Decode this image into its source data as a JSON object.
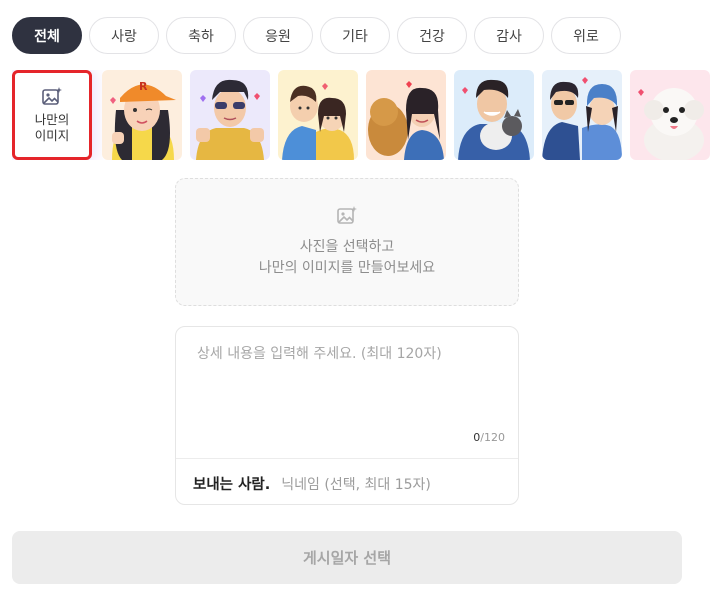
{
  "categories": [
    {
      "label": "전체",
      "active": true
    },
    {
      "label": "사랑",
      "active": false
    },
    {
      "label": "축하",
      "active": false
    },
    {
      "label": "응원",
      "active": false
    },
    {
      "label": "기타",
      "active": false
    },
    {
      "label": "건강",
      "active": false
    },
    {
      "label": "감사",
      "active": false
    },
    {
      "label": "위로",
      "active": false
    }
  ],
  "my_image": {
    "label": "나만의\n이미지",
    "icon": "image-plus-icon"
  },
  "thumbnails": [
    {
      "name": "thumb-girl-orange-cap",
      "bg": "#fdeede"
    },
    {
      "name": "thumb-boy-sunglasses",
      "bg": "#ece9fb"
    },
    {
      "name": "thumb-kids-hug",
      "bg": "#fdf2cf"
    },
    {
      "name": "thumb-woman-dog",
      "bg": "#fde4d4"
    },
    {
      "name": "thumb-man-cat",
      "bg": "#dcecfa"
    },
    {
      "name": "thumb-couple-winter",
      "bg": "#e6f0fa"
    },
    {
      "name": "thumb-white-dog",
      "bg": "#fde6ec"
    }
  ],
  "upload": {
    "line1": "사진을 선택하고",
    "line2": "나만의 이미지를 만들어보세요",
    "icon": "image-plus-icon"
  },
  "message": {
    "placeholder": "상세 내용을 입력해 주세요. (최대 120자)",
    "count": "0",
    "max": "/120"
  },
  "sender": {
    "label": "보내는 사람.",
    "placeholder": "닉네임 (선택, 최대 15자)"
  },
  "post_button": {
    "label": "게시일자 선택"
  }
}
